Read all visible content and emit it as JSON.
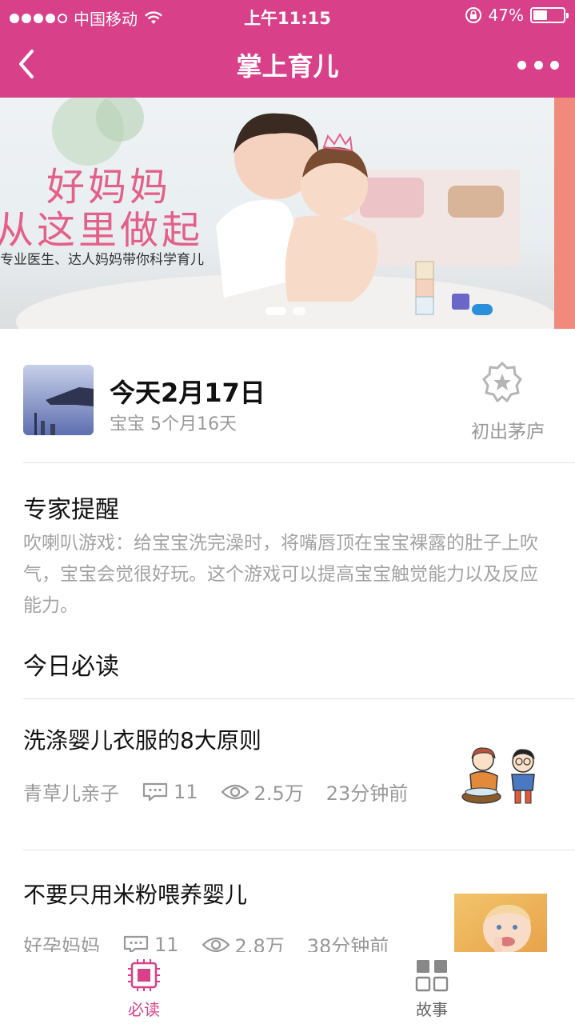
{
  "status_bar": {
    "carrier": "中国移动",
    "time": "上午11:15",
    "battery_percent": "47%",
    "battery_level": 0.47,
    "signal_bars_filled": 4,
    "signal_bars_total": 5
  },
  "nav": {
    "title": "掌上育儿",
    "back_icon": "chevron-left-icon",
    "more_icon": "more-dots-icon"
  },
  "banner": {
    "line1": "好妈妈",
    "line2": "从这里做起",
    "subtitle": "专业医生、达人妈妈带你科学育儿",
    "pages": 2,
    "current_page": 1
  },
  "profile": {
    "date": "今天2月17日",
    "age": "宝宝 5个月16天",
    "badge_label": "初出茅庐",
    "badge_icon": "medal-star-icon"
  },
  "expert_tip": {
    "title": "专家提醒",
    "text": "吹喇叭游戏：给宝宝洗完澡时，将嘴唇顶在宝宝裸露的肚子上吹气，宝宝会觉很好玩。这个游戏可以提高宝宝触觉能力以及反应能力。"
  },
  "daily_reading": {
    "title": "今日必读"
  },
  "articles": [
    {
      "title": "洗涤婴儿衣服的8大原则",
      "source": "青草儿亲子",
      "comments": "11",
      "views": "2.5万",
      "time": "23分钟前"
    },
    {
      "title": "不要只用米粉喂养婴儿",
      "source": "好孕妈妈",
      "comments": "11",
      "views": "2.8万",
      "time": "38分钟前"
    }
  ],
  "tabs": [
    {
      "label": "必读",
      "icon": "chip-icon",
      "active": true
    },
    {
      "label": "故事",
      "icon": "grid-icon",
      "active": false
    }
  ],
  "colors": {
    "brand": "#d9408a",
    "muted_text": "#999999",
    "tip_text": "#a3a3a3",
    "divider": "#e2e2e2"
  }
}
